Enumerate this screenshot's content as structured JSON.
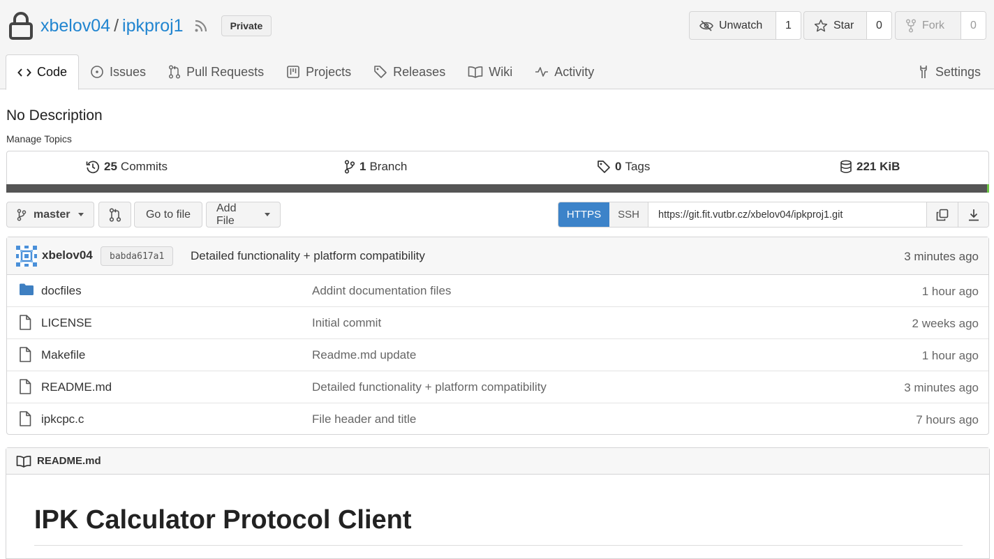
{
  "repo": {
    "owner": "xbelov04",
    "slash": "/",
    "name": "ipkproj1",
    "visibility": "Private"
  },
  "actions": {
    "unwatch": {
      "label": "Unwatch",
      "count": "1"
    },
    "star": {
      "label": "Star",
      "count": "0"
    },
    "fork": {
      "label": "Fork",
      "count": "0"
    }
  },
  "tabs": [
    {
      "label": "Code",
      "icon": "code-icon",
      "active": true
    },
    {
      "label": "Issues",
      "icon": "issue-icon"
    },
    {
      "label": "Pull Requests",
      "icon": "pull-request-icon"
    },
    {
      "label": "Projects",
      "icon": "project-icon"
    },
    {
      "label": "Releases",
      "icon": "tag-icon"
    },
    {
      "label": "Wiki",
      "icon": "book-icon"
    },
    {
      "label": "Activity",
      "icon": "pulse-icon"
    },
    {
      "label": "Settings",
      "icon": "tools-icon"
    }
  ],
  "description": "No Description",
  "manage_topics": "Manage Topics",
  "stats": {
    "commits": {
      "count": "25",
      "label": "Commits"
    },
    "branches": {
      "count": "1",
      "label": "Branch"
    },
    "tags": {
      "count": "0",
      "label": "Tags"
    },
    "size": {
      "value": "221 KiB"
    }
  },
  "toolbar": {
    "branch": "master",
    "go_to_file": "Go to file",
    "add_file": "Add File",
    "https": "HTTPS",
    "ssh": "SSH",
    "clone_url": "https://git.fit.vutbr.cz/xbelov04/ipkproj1.git"
  },
  "latest_commit": {
    "author": "xbelov04",
    "sha": "babda617a1",
    "message": "Detailed functionality + platform compatibility",
    "age": "3 minutes ago"
  },
  "files": [
    {
      "name": "docfiles",
      "type": "folder",
      "message": "Addint documentation files",
      "age": "1 hour ago"
    },
    {
      "name": "LICENSE",
      "type": "file",
      "message": "Initial commit",
      "age": "2 weeks ago"
    },
    {
      "name": "Makefile",
      "type": "file",
      "message": "Readme.md update",
      "age": "1 hour ago"
    },
    {
      "name": "README.md",
      "type": "file",
      "message": "Detailed functionality + platform compatibility",
      "age": "3 minutes ago"
    },
    {
      "name": "ipkcpc.c",
      "type": "file",
      "message": "File header and title",
      "age": "7 hours ago"
    }
  ],
  "readme": {
    "filename": "README.md",
    "heading": "IPK Calculator Protocol Client"
  },
  "colors": {
    "link": "#2185d0",
    "https_active": "#3c83c9",
    "folder": "#3e7fc1",
    "language_bar": "#555555",
    "language_accent": "#6cc644"
  }
}
